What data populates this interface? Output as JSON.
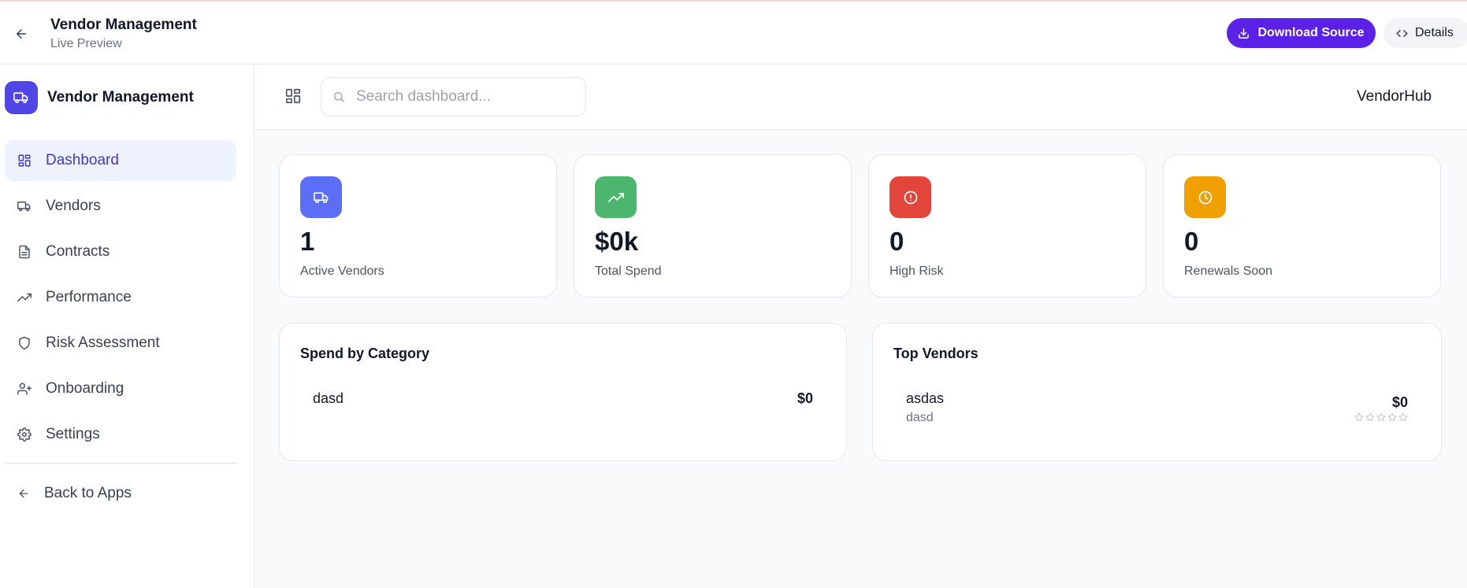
{
  "header": {
    "title": "Vendor Management",
    "subtitle": "Live Preview",
    "download_label": "Download Source",
    "details_label": "Details"
  },
  "sidebar": {
    "brand": "Vendor Management",
    "items": [
      {
        "label": "Dashboard",
        "icon": "grid-icon",
        "active": true
      },
      {
        "label": "Vendors",
        "icon": "truck-icon"
      },
      {
        "label": "Contracts",
        "icon": "document-icon"
      },
      {
        "label": "Performance",
        "icon": "trending-up-icon"
      },
      {
        "label": "Risk Assessment",
        "icon": "shield-icon"
      },
      {
        "label": "Onboarding",
        "icon": "user-plus-icon"
      },
      {
        "label": "Settings",
        "icon": "gear-icon"
      }
    ],
    "back_label": "Back to Apps"
  },
  "main": {
    "search_placeholder": "Search dashboard...",
    "brand": "VendorHub",
    "stats": [
      {
        "value": "1",
        "label": "Active Vendors",
        "color": "#5b6ef5",
        "icon": "truck-icon"
      },
      {
        "value": "$0k",
        "label": "Total Spend",
        "color": "#4cb56e",
        "icon": "trending-up-icon"
      },
      {
        "value": "0",
        "label": "High Risk",
        "color": "#e2453a",
        "icon": "alert-circle-icon"
      },
      {
        "value": "0",
        "label": "Renewals Soon",
        "color": "#f0a000",
        "icon": "clock-icon"
      }
    ],
    "spend_by_category": {
      "title": "Spend by Category",
      "rows": [
        {
          "name": "dasd",
          "amount": "$0"
        }
      ]
    },
    "top_vendors": {
      "title": "Top Vendors",
      "rows": [
        {
          "name": "asdas",
          "category": "dasd",
          "amount": "$0",
          "rating": 0
        }
      ]
    }
  }
}
